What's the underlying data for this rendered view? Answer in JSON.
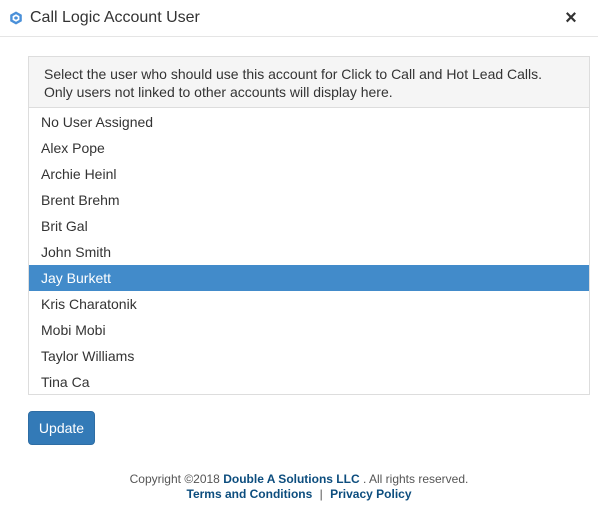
{
  "dialog": {
    "title": "Call Logic Account User",
    "close_label": "×",
    "icon": "hexagon-logo-icon"
  },
  "panel": {
    "instruction_line1": "Select the user who should use this account for Click to Call and Hot Lead Calls.",
    "instruction_line2": "Only users not linked to other accounts will display here."
  },
  "users": [
    {
      "name": "No User Assigned"
    },
    {
      "name": "Alex Pope"
    },
    {
      "name": "Archie Heinl"
    },
    {
      "name": "Brent Brehm"
    },
    {
      "name": "Brit Gal"
    },
    {
      "name": "John Smith"
    },
    {
      "name": "Jay Burkett",
      "selected": true
    },
    {
      "name": "Kris Charatonik"
    },
    {
      "name": "Mobi Mobi"
    },
    {
      "name": "Taylor Williams"
    },
    {
      "name": "Tina Ca"
    }
  ],
  "actions": {
    "update_label": "Update"
  },
  "footer": {
    "copyright_prefix": "Copyright ©2018",
    "company": "Double A Solutions LLC",
    "copyright_suffix": ". All rights reserved.",
    "terms_label": "Terms and Conditions",
    "separator": "|",
    "privacy_label": "Privacy Policy"
  },
  "colors": {
    "selected_bg": "#428bca",
    "button_bg": "#337ab7",
    "link": "#0c4d7e"
  }
}
